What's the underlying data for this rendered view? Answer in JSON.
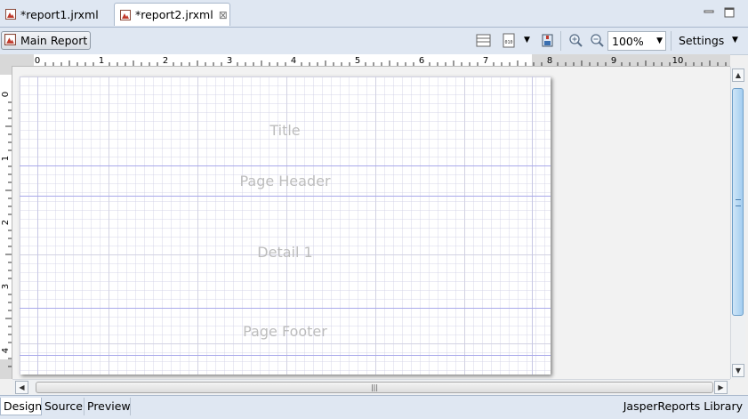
{
  "tabs": [
    {
      "label": "*report1.jrxml",
      "active": false,
      "icon": "report-icon"
    },
    {
      "label": "*report2.jrxml",
      "active": true,
      "icon": "report-icon",
      "close": "⊠"
    }
  ],
  "window_controls": {
    "minimize_icon": "minimize-icon",
    "maximize_icon": "maximize-icon"
  },
  "toolbar": {
    "main_report_label": "Main Report",
    "zoom_value": "100%",
    "settings_label": "Settings"
  },
  "ruler": {
    "horizontal_labels": [
      "0",
      "1",
      "2",
      "3",
      "4",
      "5",
      "6",
      "7",
      "8",
      "9",
      "10"
    ],
    "vertical_labels": [
      "0",
      "1",
      "2",
      "3",
      "4"
    ]
  },
  "bands": [
    {
      "label": "Title"
    },
    {
      "label": "Page Header"
    },
    {
      "label": "Detail 1"
    },
    {
      "label": "Page Footer"
    }
  ],
  "bottom_tabs": [
    {
      "label": "Design",
      "active": true
    },
    {
      "label": "Source",
      "active": false
    },
    {
      "label": "Preview",
      "active": false
    }
  ],
  "library_label": "JasperReports Library"
}
